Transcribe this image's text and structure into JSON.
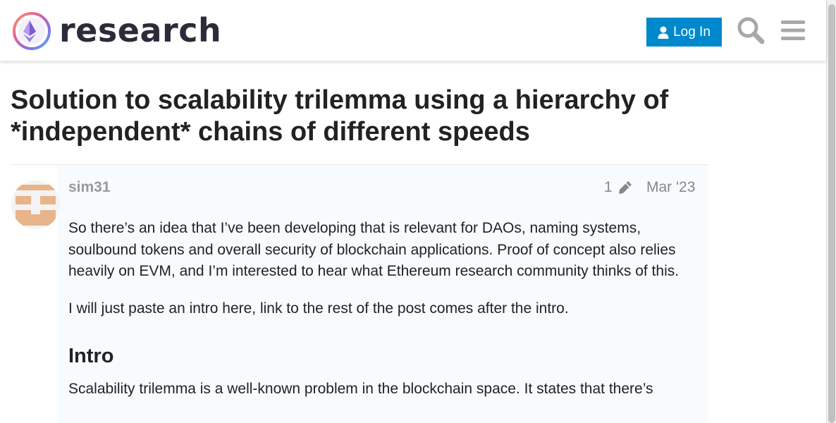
{
  "header": {
    "site_name": "research",
    "login_label": "Log In",
    "search_icon": "search-icon",
    "menu_icon": "hamburger-icon",
    "accent": "#0088cc"
  },
  "topic": {
    "title": "Solution to scalability trilemma using a hierarchy of *independent* chains of different speeds"
  },
  "post": {
    "username": "sim31",
    "edit_count": "1",
    "date": "Mar '23",
    "paragraphs": [
      "So there’s an idea that I’ve been developing that is relevant for DAOs, naming systems, soulbound tokens and overall security of blockchain applications. Proof of concept also relies heavily on EVM, and I’m interested to hear what Ethereum research community thinks of this.",
      "I will just paste an intro here, link to the rest of the post comes after the intro."
    ],
    "heading": "Intro",
    "intro_text": "Scalability trilemma is a well-known problem in the blockchain space. It states that there’s"
  }
}
